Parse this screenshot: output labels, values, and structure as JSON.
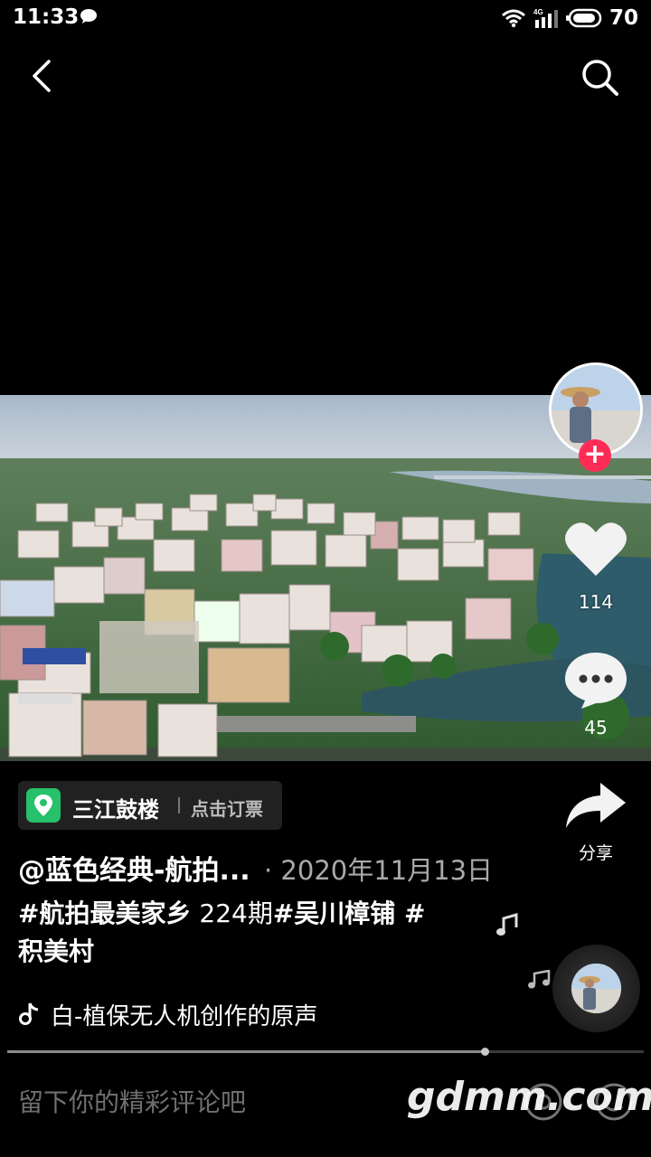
{
  "status_bar": {
    "time": "11:33",
    "network": "4G",
    "battery": "70"
  },
  "nav": {
    "back_icon": "chevron-left-icon",
    "search_icon": "search-icon"
  },
  "side_actions": {
    "like_count": "114",
    "comment_count": "45",
    "share_label": "分享"
  },
  "location": {
    "name": "三江鼓楼",
    "action": "点击订票"
  },
  "post": {
    "author": "@蓝色经典-航拍...",
    "date": "· 2020年11月13日",
    "caption_part1": "#航拍最美家乡",
    "caption_part2": "224期",
    "caption_part3": "#吴川樟铺 #",
    "caption_part4": "积美村"
  },
  "music": {
    "title": "白-植保无人机创作的原声"
  },
  "playback": {
    "progress": 0.75
  },
  "comment_bar": {
    "placeholder": "留下你的精彩评论吧"
  },
  "watermark": "gdmm.com",
  "colors": {
    "background": "#000000",
    "follow_red": "#fe2c55",
    "location_green": "#26c16a"
  }
}
